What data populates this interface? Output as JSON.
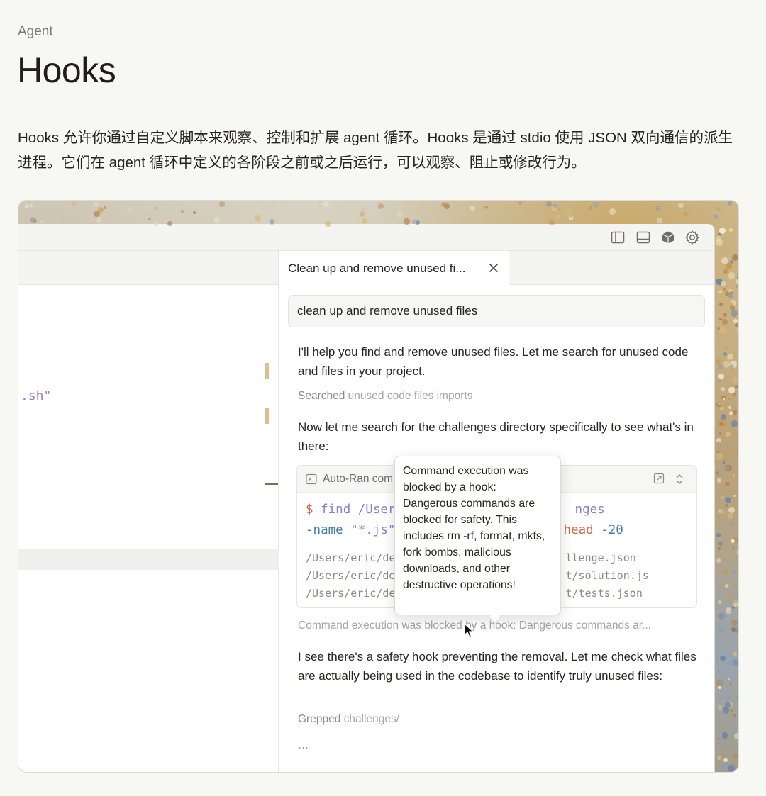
{
  "page": {
    "eyebrow": "Agent",
    "title": "Hooks",
    "intro": "Hooks 允许你通过自定义脚本来观察、控制和扩展 agent 循环。Hooks 是通过 stdio 使用 JSON 双向通信的派生进程。它们在 agent 循环中定义的各阶段之前或之后运行，可以观察、阻止或修改行为。"
  },
  "window": {
    "titlebar_icons": [
      "sidebar-toggle-icon",
      "bottom-panel-icon",
      "cube-icon",
      "gear-icon"
    ],
    "editor": {
      "code_fragment": ".sh\""
    },
    "chat": {
      "tab_title": "Clean up and remove unused fi...",
      "prompt": "clean up and remove unused files",
      "messages": {
        "m1": "I'll help you find and remove unused files. Let me search for unused code and files in your project.",
        "m2": "Now let me search for the challenges directory specifically to see what's in there:",
        "m3": "I see there's a safety hook preventing the removal. Let me check what files are actually being used in the codebase to identify truly unused files:"
      },
      "tool_searched": {
        "verb": "Searched",
        "detail": "unused code files imports"
      },
      "tool_grepped": {
        "verb": "Grepped",
        "detail": "challenges/"
      },
      "tool_blocked": "Command execution was blocked by a hook: Dangerous commands ar...",
      "ellipsis": "...",
      "terminal": {
        "header": "Auto-Ran comma",
        "cmd_line1": {
          "prompt": "$",
          "cmd": "find /Users/",
          "tail": "nges"
        },
        "cmd_line2": {
          "flag": "-name",
          "str": "\"*.js\"",
          "pipe": " ·",
          "head": "head",
          "num": " -20"
        },
        "output": [
          {
            "left": "/Users/eric/dev/",
            "right": "llenge.json"
          },
          {
            "left": "/Users/eric/dev/",
            "right": "t/solution.js"
          },
          {
            "left": "/Users/eric/dev/",
            "right": "t/tests.json"
          }
        ]
      },
      "tooltip": "Command execution was blocked by a hook: Dangerous commands are blocked for safety. This includes rm -rf, format, mkfs, fork bombs, malicious downloads, and other destructive operations!"
    }
  },
  "colors": {
    "accent_orange": "#d36b46",
    "accent_purple": "#8d7fd0",
    "accent_blue": "#3f7fa5",
    "gutter_mark": "#e0bf8e"
  }
}
